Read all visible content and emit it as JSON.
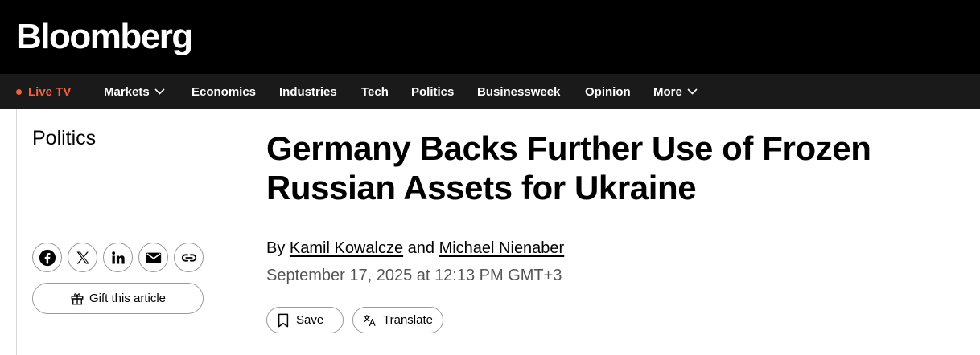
{
  "header": {
    "logo": "Bloomberg"
  },
  "nav": {
    "live": "Live TV",
    "items": [
      {
        "label": "Markets",
        "dropdown": true
      },
      {
        "label": "Economics",
        "dropdown": false
      },
      {
        "label": "Industries",
        "dropdown": false
      },
      {
        "label": "Tech",
        "dropdown": false
      },
      {
        "label": "Politics",
        "dropdown": false
      },
      {
        "label": "Businessweek",
        "dropdown": false
      },
      {
        "label": "Opinion",
        "dropdown": false
      },
      {
        "label": "More",
        "dropdown": true
      }
    ]
  },
  "article": {
    "section": "Politics",
    "headline": "Germany Backs Further Use of Frozen Russian Assets for Ukraine",
    "byline_prefix": "By",
    "authors": [
      "Kamil Kowalcze",
      "Michael Nienaber"
    ],
    "byline_joiner": "and",
    "date": "September 17, 2025 at 12:13 PM GMT+3"
  },
  "share": {
    "icons": [
      "facebook-icon",
      "x-icon",
      "linkedin-icon",
      "email-icon",
      "link-icon"
    ],
    "gift_label": "Gift this article"
  },
  "actions": {
    "save_label": "Save",
    "translate_label": "Translate"
  },
  "colors": {
    "live": "#f5603f",
    "topbar": "#000000",
    "navbar": "#1a1a1a"
  }
}
